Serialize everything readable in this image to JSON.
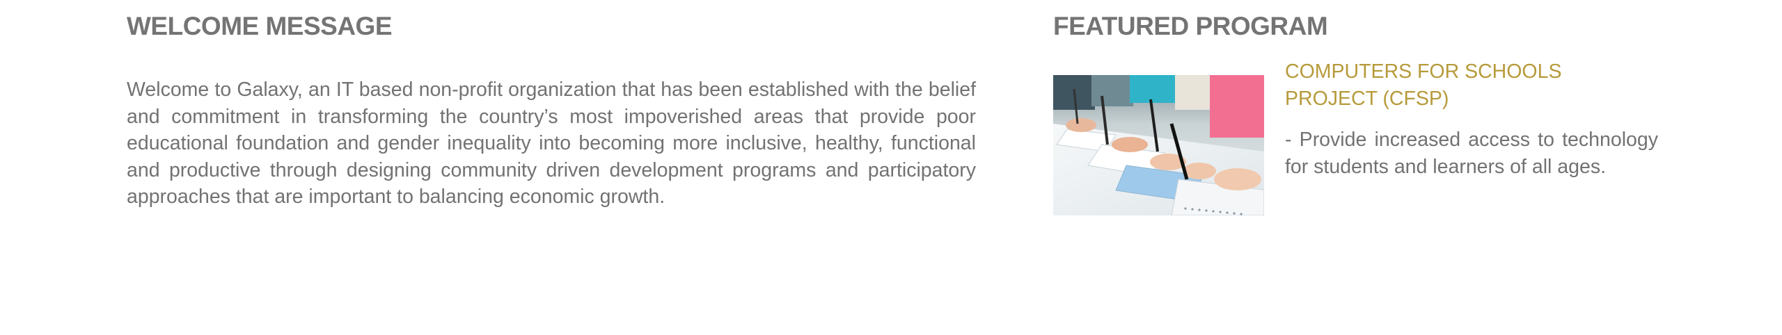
{
  "welcome": {
    "title": "WELCOME MESSAGE",
    "body": "Welcome to Galaxy, an IT based non-profit organization that has been established with the belief and commitment in transforming the country’s most impoverished areas that provide poor educational foundation and gender inequality into becoming more inclusive, healthy, functional and productive through designing community driven development programs and participatory approaches that are important to balancing economic growth."
  },
  "featured": {
    "title": "FEATURED PROGRAM",
    "program": {
      "image_icon": "students-writing-photo",
      "title": "COMPUTERS FOR SCHOOLS PROJECT (CFSP)",
      "description": "- Provide increased access to technology for students and learners of all ages."
    }
  },
  "colors": {
    "heading": "#747474",
    "text": "#727272",
    "accent": "#b69a3a"
  }
}
